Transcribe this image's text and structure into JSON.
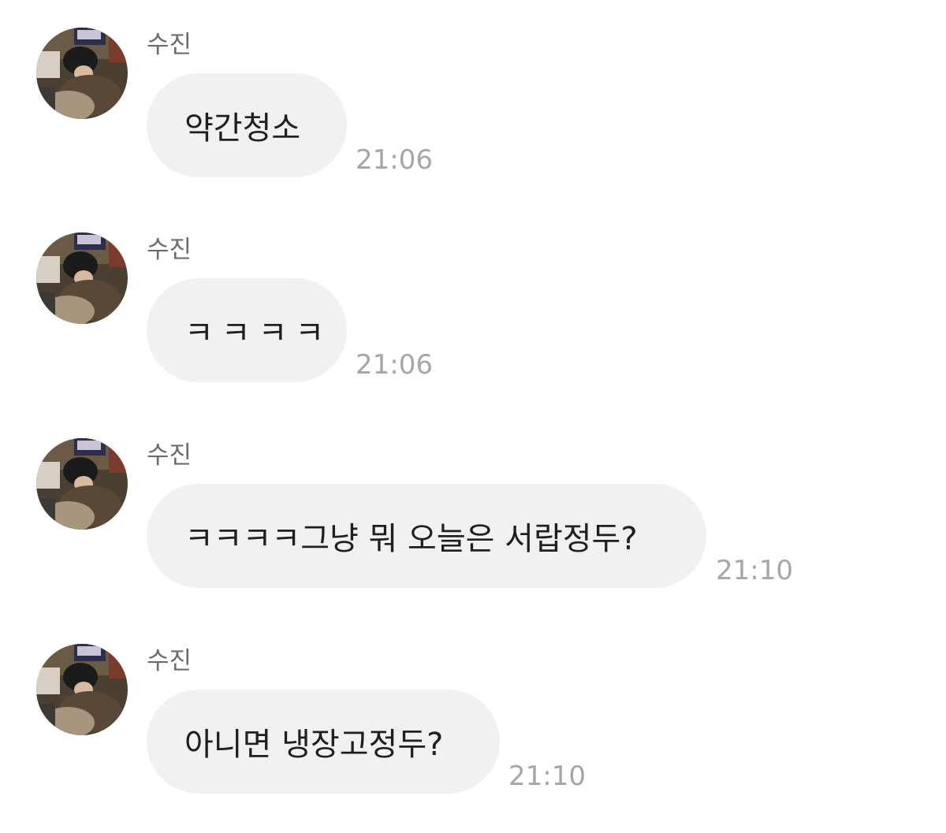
{
  "messages": [
    {
      "sender": "수진",
      "text": "약간청소",
      "time": "21:06"
    },
    {
      "sender": "수진",
      "text": "ㅋㅋㅋㅋ",
      "time": "21:06"
    },
    {
      "sender": "수진",
      "text": "ㅋㅋㅋㅋ그냥 뭐 오늘은 서랍정두?",
      "time": "21:10"
    },
    {
      "sender": "수진",
      "text": "아니면 냉장고정두?",
      "time": "21:10"
    }
  ],
  "avatar_icon": "profile-photo",
  "colors": {
    "bubble": "#f1f1f4",
    "sender": "#6c6c70",
    "time": "#a5a5aa",
    "text": "#1f1f1f"
  }
}
